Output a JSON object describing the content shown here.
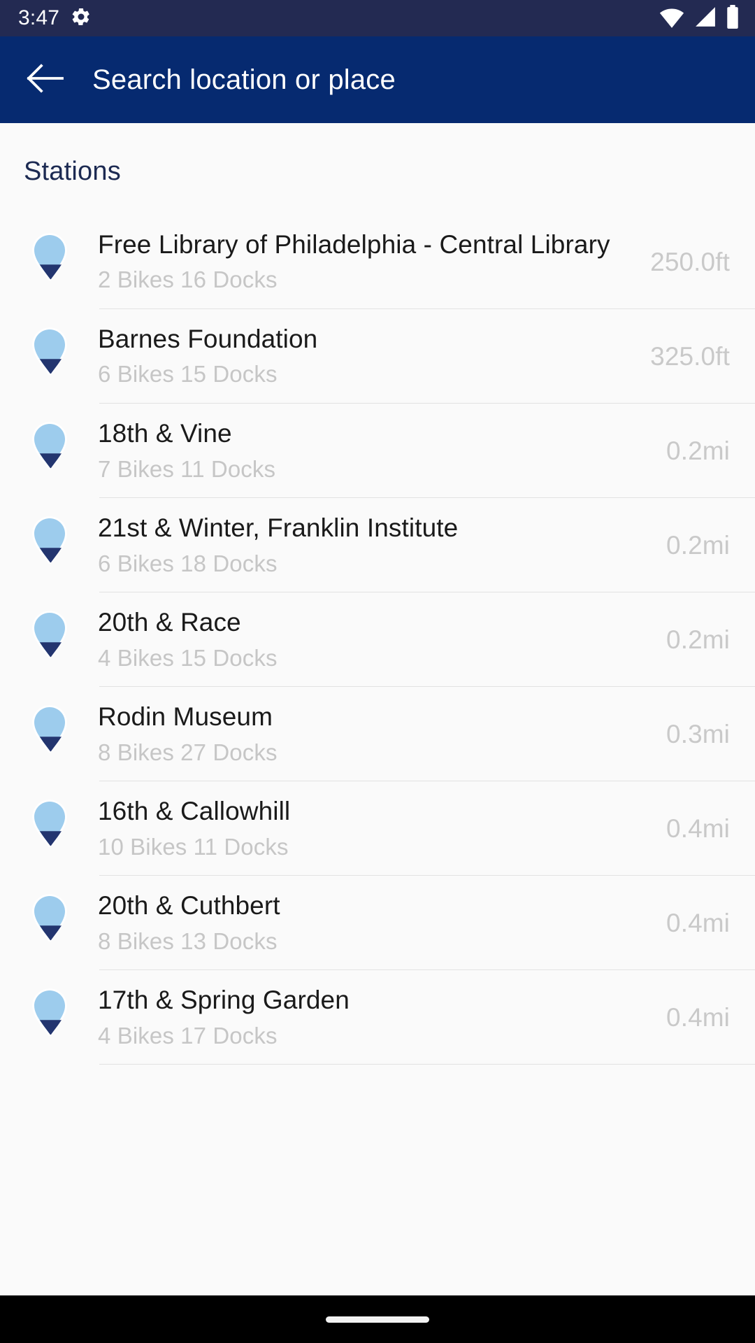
{
  "status_bar": {
    "time": "3:47",
    "icons": [
      "gear-icon",
      "wifi-icon",
      "cellular-signal-icon",
      "battery-icon"
    ],
    "background_color": "#232a52"
  },
  "app_bar": {
    "back_label": "back-arrow-icon",
    "title": "Search location or place",
    "background_color": "#062a70",
    "text_color": "#ffffff"
  },
  "content": {
    "section_title": "Stations",
    "background_color": "#fafafa"
  },
  "colors": {
    "pin_top": "#9dcced",
    "pin_bottom": "#23356f",
    "primary_text": "#1a1a1a",
    "secondary_text": "#c6c6c6",
    "distance_text": "#c9c9c9",
    "divider": "#e2e2e2"
  },
  "stations": [
    {
      "name": "Free Library of Philadelphia - Central Library",
      "availability": "2 Bikes 16 Docks",
      "distance": "250.0ft"
    },
    {
      "name": "Barnes Foundation",
      "availability": "6 Bikes 15 Docks",
      "distance": "325.0ft"
    },
    {
      "name": "18th & Vine",
      "availability": "7 Bikes 11 Docks",
      "distance": "0.2mi"
    },
    {
      "name": "21st & Winter, Franklin Institute",
      "availability": "6 Bikes 18 Docks",
      "distance": "0.2mi"
    },
    {
      "name": "20th & Race",
      "availability": "4 Bikes 15 Docks",
      "distance": "0.2mi"
    },
    {
      "name": "Rodin Museum",
      "availability": "8 Bikes 27 Docks",
      "distance": "0.3mi"
    },
    {
      "name": "16th & Callowhill",
      "availability": "10 Bikes 11 Docks",
      "distance": "0.4mi"
    },
    {
      "name": "20th & Cuthbert",
      "availability": "8 Bikes 13 Docks",
      "distance": "0.4mi"
    },
    {
      "name": "17th & Spring Garden",
      "availability": "4 Bikes 17 Docks",
      "distance": "0.4mi"
    }
  ],
  "nav_bar": {
    "home_indicator": "home-indicator",
    "background_color": "#000000"
  }
}
